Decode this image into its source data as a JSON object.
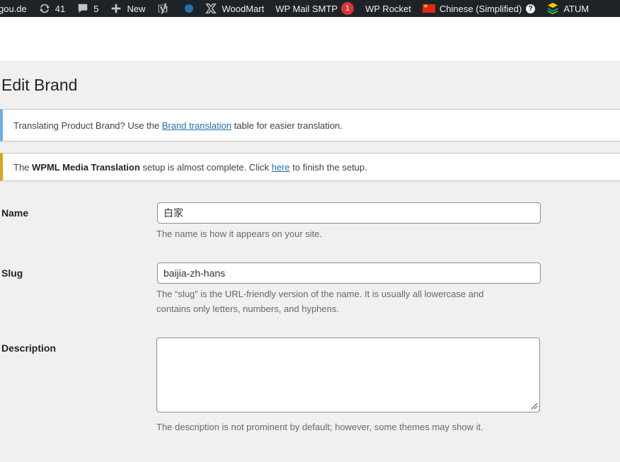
{
  "adminbar": {
    "site": "gou.de",
    "updates_count": "41",
    "comments_count": "5",
    "new_label": "New",
    "woodmart_label": "WoodMart",
    "smtp_label": "WP Mail SMTP",
    "smtp_badge": "1",
    "rocket_label": "WP Rocket",
    "language_label": "Chinese (Simplified)",
    "help_glyph": "?",
    "atum_label": "ATUM"
  },
  "page": {
    "title": "Edit Brand"
  },
  "notices": {
    "info": {
      "before": "Translating Product Brand? Use the ",
      "link": "Brand translation",
      "after": " table for easier translation."
    },
    "warning": {
      "before": "The ",
      "strong": "WPML Media Translation",
      "middle": " setup is almost complete. Click ",
      "link": "here",
      "after": " to finish the setup."
    }
  },
  "form": {
    "name": {
      "label": "Name",
      "value": "白家",
      "help": "The name is how it appears on your site."
    },
    "slug": {
      "label": "Slug",
      "value": "baijia-zh-hans",
      "help": "The “slug” is the URL-friendly version of the name. It is usually all lowercase and contains only letters, numbers, and hyphens."
    },
    "description": {
      "label": "Description",
      "value": "",
      "help": "The description is not prominent by default; however, some themes may show it."
    }
  },
  "colors": {
    "adminbar_bg": "#1d2327",
    "info_border": "#72aee6",
    "warning_border": "#dba617",
    "link": "#2271b1",
    "badge": "#d63638"
  }
}
